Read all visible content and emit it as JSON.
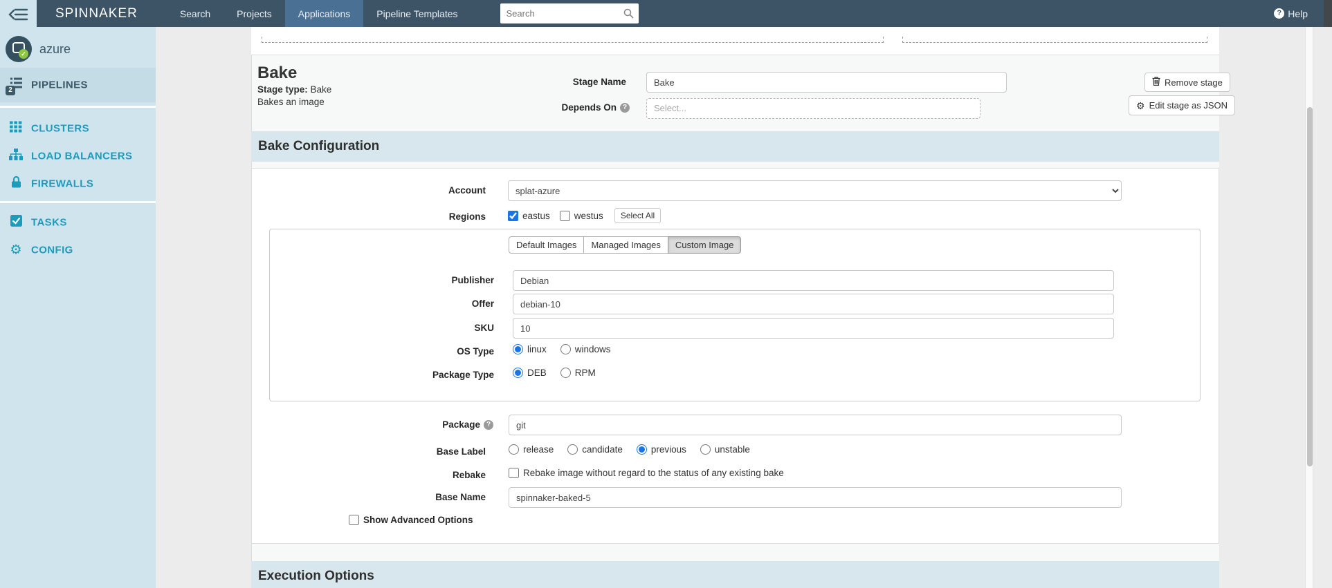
{
  "colors": {
    "navbar_bg": "#3d5467",
    "navbar_active_bg": "#4a7094",
    "sidebar_bg": "#cfe4ec",
    "sidebar_accent": "#1a9cba",
    "section_header_bg": "#d8e7ed",
    "control_accent_blue": "#1a73e8",
    "app_check_green": "#8dc63f"
  },
  "navbar": {
    "brand": "SPINNAKER",
    "items": [
      {
        "label": "Search"
      },
      {
        "label": "Projects"
      },
      {
        "label": "Applications"
      },
      {
        "label": "Pipeline Templates"
      }
    ],
    "search_placeholder": "Search",
    "help_label": "Help",
    "help_icon_glyph": "?"
  },
  "sidebar": {
    "app_name": "azure",
    "app_check_glyph": "✓",
    "pipelines": {
      "label": "PIPELINES",
      "badge": "2"
    },
    "items": [
      {
        "label": "CLUSTERS"
      },
      {
        "label": "LOAD BALANCERS"
      },
      {
        "label": "FIREWALLS"
      },
      {
        "label": "TASKS"
      },
      {
        "label": "CONFIG"
      }
    ],
    "config_gear_glyph": "⚙"
  },
  "stage": {
    "title": "Bake",
    "type_label": "Stage type:",
    "type_value": "Bake",
    "description": "Bakes an image",
    "stage_name_label": "Stage Name",
    "stage_name_value": "Bake",
    "depends_on_label": "Depends On",
    "depends_on_help_glyph": "?",
    "depends_on_placeholder": "Select...",
    "remove_stage_label": "Remove stage",
    "edit_json_label": "Edit stage as JSON",
    "edit_json_gear_glyph": "⚙"
  },
  "bake_config": {
    "section_title": "Bake Configuration",
    "account_label": "Account",
    "account_value": "splat-azure",
    "regions_label": "Regions",
    "regions": [
      {
        "label": "eastus",
        "checked": true
      },
      {
        "label": "westus",
        "checked": false
      }
    ],
    "select_all_label": "Select All",
    "image_tabs": [
      {
        "label": "Default Images",
        "active": false
      },
      {
        "label": "Managed Images",
        "active": false
      },
      {
        "label": "Custom Image",
        "active": true
      }
    ],
    "publisher_label": "Publisher",
    "publisher_value": "Debian",
    "offer_label": "Offer",
    "offer_value": "debian-10",
    "sku_label": "SKU",
    "sku_value": "10",
    "os_type_label": "OS Type",
    "os_type_options": [
      {
        "label": "linux",
        "selected": true
      },
      {
        "label": "windows",
        "selected": false
      }
    ],
    "package_type_label": "Package Type",
    "package_type_options": [
      {
        "label": "DEB",
        "selected": true
      },
      {
        "label": "RPM",
        "selected": false
      }
    ],
    "package_label": "Package",
    "package_help_glyph": "?",
    "package_value": "git",
    "base_label_label": "Base Label",
    "base_label_options": [
      {
        "label": "release",
        "selected": false
      },
      {
        "label": "candidate",
        "selected": false
      },
      {
        "label": "previous",
        "selected": true
      },
      {
        "label": "unstable",
        "selected": false
      }
    ],
    "rebake_label": "Rebake",
    "rebake_text": "Rebake image without regard to the status of any existing bake",
    "rebake_checked": false,
    "base_name_label": "Base Name",
    "base_name_value": "spinnaker-baked-5",
    "show_advanced_label": "Show Advanced Options",
    "show_advanced_checked": false
  },
  "execution_options": {
    "section_title": "Execution Options"
  }
}
